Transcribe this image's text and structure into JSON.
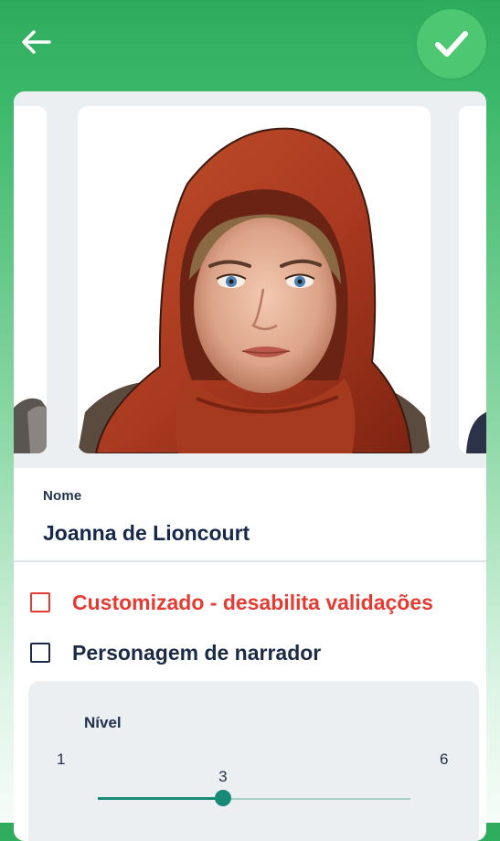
{
  "header": {
    "back_icon": "arrow-left-icon",
    "confirm_icon": "check-icon",
    "confirm_color": "#4ec773"
  },
  "character": {
    "name_label": "Nome",
    "name_value": "Joanna de Lioncourt"
  },
  "options": {
    "custom_label": "Customizado - desabilita validações",
    "custom_checked": false,
    "custom_color": "#e53b33",
    "narrator_label": "Personagem de narrador",
    "narrator_checked": false
  },
  "level": {
    "label": "Nível",
    "min": "1",
    "max": "6",
    "value": "3",
    "accent_color": "#168a74"
  }
}
